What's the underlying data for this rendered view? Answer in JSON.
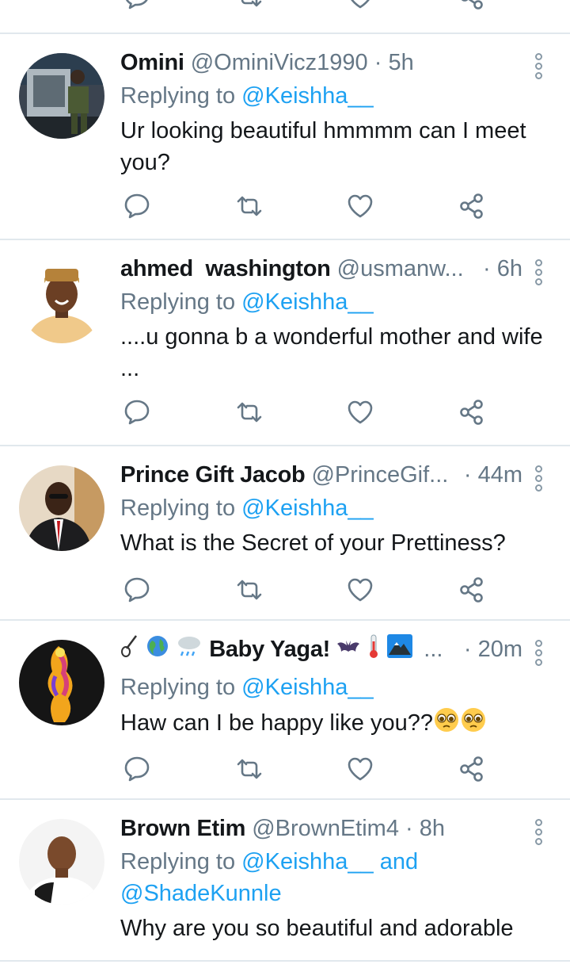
{
  "colors": {
    "text": "#14171a",
    "secondary": "#657786",
    "link": "#1da1f2",
    "divider": "#e1e8ed",
    "icon": "#657786"
  },
  "replying_prefix": "Replying to",
  "tweets": [
    {
      "name": "Omini",
      "handle": "@OminiVicz1990",
      "time": "5h",
      "mentions": [
        "@Keishha__"
      ],
      "text": "Ur looking beautiful hmmmm can I meet you?"
    },
    {
      "name": "ahmed  washington",
      "handle": "@usmanw...",
      "time": "6h",
      "mentions": [
        "@Keishha__"
      ],
      "text": "....u gonna b a wonderful mother and wife ..."
    },
    {
      "name": "Prince Gift Jacob",
      "handle": "@PrinceGif...",
      "time": "44m",
      "mentions": [
        "@Keishha__"
      ],
      "text": "What is the Secret of your Prettiness?"
    },
    {
      "name": "Baby Yaga!",
      "name_extra": "...",
      "time": "20m",
      "mentions": [
        "@Keishha__"
      ],
      "text": "Haw can I be happy like you??",
      "name_emojis": [
        "guitar-emoji",
        "globe-emoji",
        "rain-cloud-emoji",
        "bat-emoji",
        "thermometer-emoji",
        "mountain-emoji"
      ],
      "text_emojis": [
        "pleading-face-emoji",
        "pleading-face-emoji"
      ]
    },
    {
      "name": "Brown Etim",
      "handle": "@BrownEtim4",
      "time": "8h",
      "mentions": [
        "@Keishha__",
        "@ShadeKunnle"
      ],
      "and": "and",
      "text": "Why are you so beautiful and adorable"
    }
  ],
  "icons": [
    "reply-icon",
    "retweet-icon",
    "like-icon",
    "share-icon",
    "more-options-icon"
  ]
}
